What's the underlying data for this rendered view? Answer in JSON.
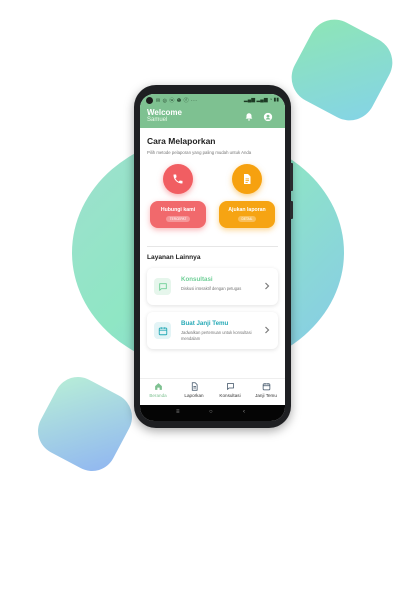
{
  "colors": {
    "header_green": "#7ec191",
    "call_red": "#f15e62",
    "report_orange": "#f6a10f",
    "konsultasi_green": "#6fcf97",
    "janji_teal": "#26a9b6",
    "nav_active": "#7ec191"
  },
  "status_bar": {
    "left_icons": "✉ ◎ ⓦ ❶ ⓕ ···",
    "right_icons": "▂▄▆ ▂▄▆ ◔ ▮▮"
  },
  "header": {
    "title": "Welcome",
    "username": "Samuel",
    "icons": [
      "bell-icon",
      "user-circle-icon"
    ]
  },
  "report": {
    "title": "Cara Melaporkan",
    "subtitle": "Pilih metode pelaporan yang paling mudah untuk Anda",
    "call": {
      "label": "Hubungi kami",
      "badge": "TERCEPAT",
      "icon": "phone-icon"
    },
    "submit": {
      "label": "Ajukan laporan",
      "badge": "DETAIL",
      "icon": "document-icon"
    }
  },
  "services": {
    "title": "Layanan Lainnya",
    "items": [
      {
        "title": "Konsultasi",
        "description": "Diskusi interaktif dengan petugas",
        "icon": "chat-icon"
      },
      {
        "title": "Buat Janji Temu",
        "description": "Jadwalkan pertemuan untuk konsultasi mendalam",
        "icon": "calendar-icon"
      }
    ]
  },
  "bottom_nav": [
    {
      "label": "Beranda",
      "icon": "home-icon",
      "active": true
    },
    {
      "label": "Laporkan",
      "icon": "document-icon",
      "active": false
    },
    {
      "label": "Konsultasi",
      "icon": "chat-icon",
      "active": false
    },
    {
      "label": "Janji Temu",
      "icon": "calendar-icon",
      "active": false
    }
  ],
  "system_nav": {
    "recent": "≡",
    "home": "○",
    "back": "‹"
  }
}
